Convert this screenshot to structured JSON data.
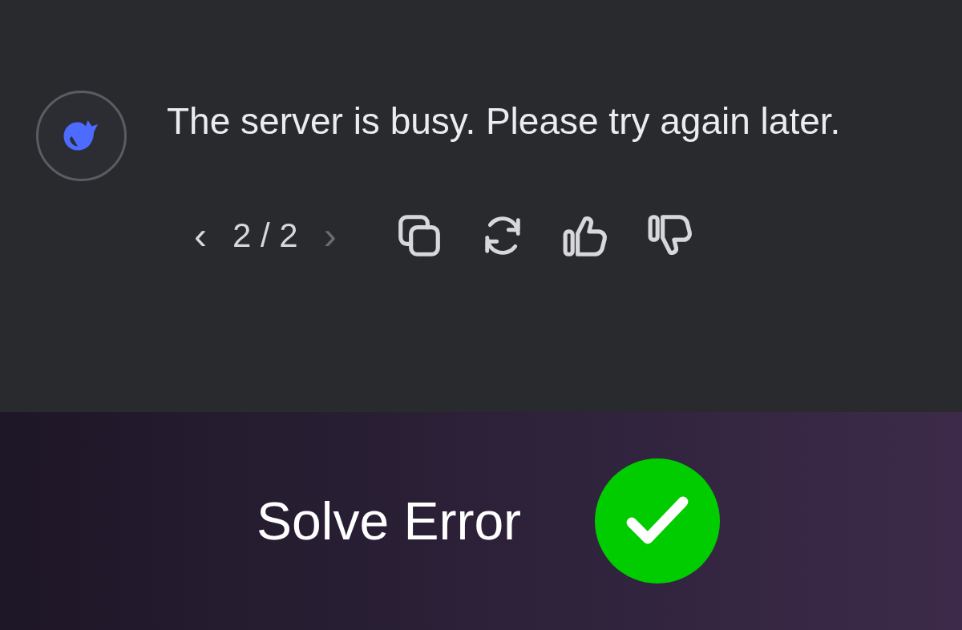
{
  "message": {
    "text": "The server is busy. Please try again later."
  },
  "pager": {
    "previous": {
      "label": "‹",
      "disabled": false
    },
    "count": "2 / 2",
    "next": {
      "label": "›",
      "disabled": true
    }
  },
  "actions": [
    {
      "kind": "copy"
    },
    {
      "kind": "regenerate"
    },
    {
      "kind": "like"
    },
    {
      "kind": "dislike"
    }
  ],
  "banner": {
    "title": "Solve Error",
    "checked": true
  }
}
